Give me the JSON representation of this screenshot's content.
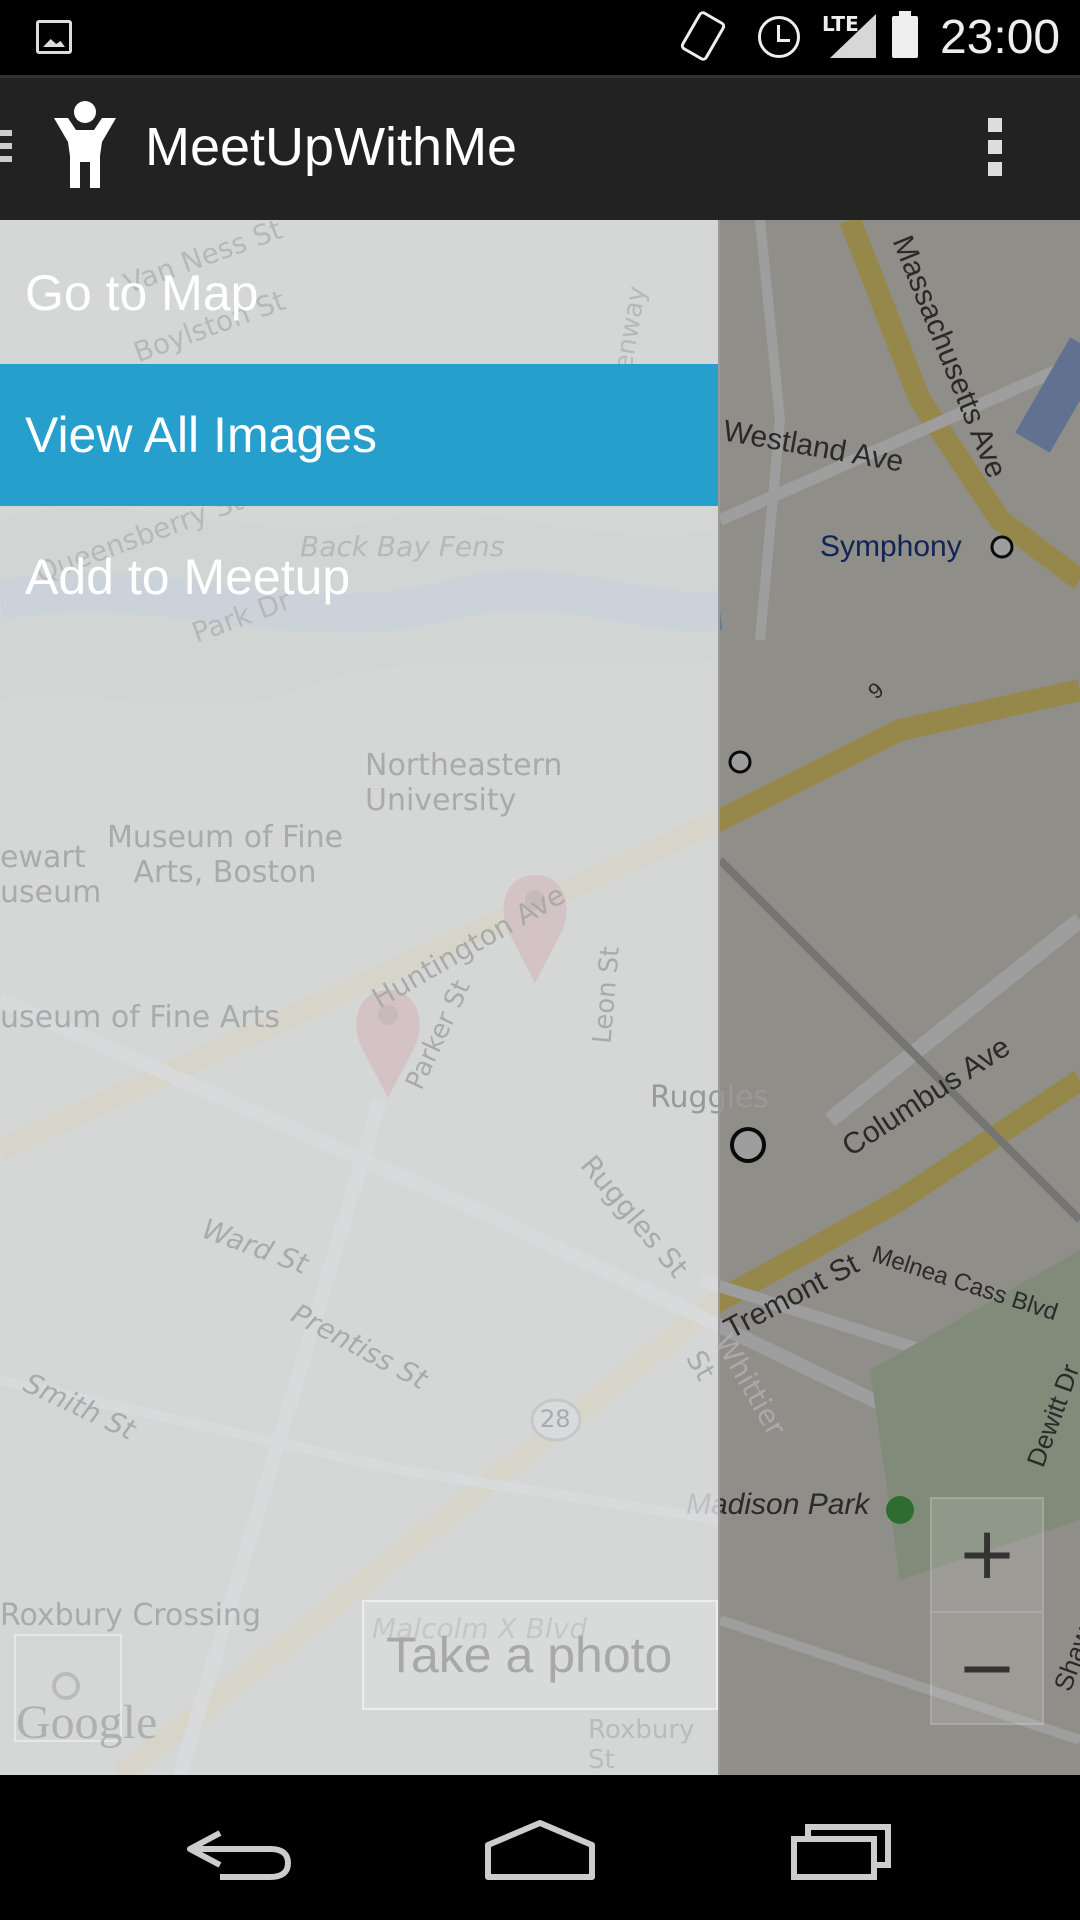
{
  "status_bar": {
    "time": "23:00",
    "network": "LTE",
    "icons": [
      "image-notification-icon",
      "screen-rotation-icon",
      "alarm-icon",
      "signal-icon",
      "battery-icon"
    ]
  },
  "action_bar": {
    "title": "MeetUpWithMe",
    "icons": [
      "drawer-indicator-icon",
      "app-person-icon",
      "overflow-menu-icon"
    ]
  },
  "drawer": {
    "items": [
      {
        "label": "Go to Map",
        "active": false
      },
      {
        "label": "View All Images",
        "active": true
      },
      {
        "label": "Add to Meetup",
        "active": false
      }
    ]
  },
  "map": {
    "labels": {
      "van_ness": "Van Ness St",
      "boylston": "Boylston St",
      "fenway": "Fenway",
      "queensberry": "Queensberry St",
      "park_dr": "Park Dr",
      "back_bay_fens": "Back Bay Fens",
      "westland": "Westland Ave",
      "massachusetts": "Massachusetts Ave",
      "symphony": "Symphony",
      "northeastern": "Northeastern University",
      "mfa": "Museum of Fine Arts, Boston",
      "gardner": "ewart useum",
      "mfa_station": "useum of Fine Arts",
      "huntington": "Huntington Ave",
      "parker": "Parker St",
      "leon": "Leon St",
      "ruggles": "Ruggles",
      "ruggles_st": "Ruggles St",
      "columbus": "Columbus Ave",
      "tremont": "Tremont St",
      "melnea": "Melnea Cass Blvd",
      "ward": "Ward St",
      "prentiss": "Prentiss St",
      "whittier": "Whittier St",
      "smith": "Smith St",
      "route28": "28",
      "route9": "9",
      "madison": "Madison Park",
      "dewitt": "Dewitt Dr",
      "shawmut": "Shawmut Ave",
      "roxbury_crossing": "Roxbury Crossing",
      "malcolm_x": "Malcolm X Blvd",
      "roxbury_st": "Roxbury St"
    },
    "take_photo": "Take a photo",
    "google": "Google",
    "zoom_in": "+",
    "zoom_out": "−"
  },
  "colors": {
    "accent": "#269fcd",
    "action_bar": "#222222",
    "drawer_scrim": "#d2d4d6"
  }
}
